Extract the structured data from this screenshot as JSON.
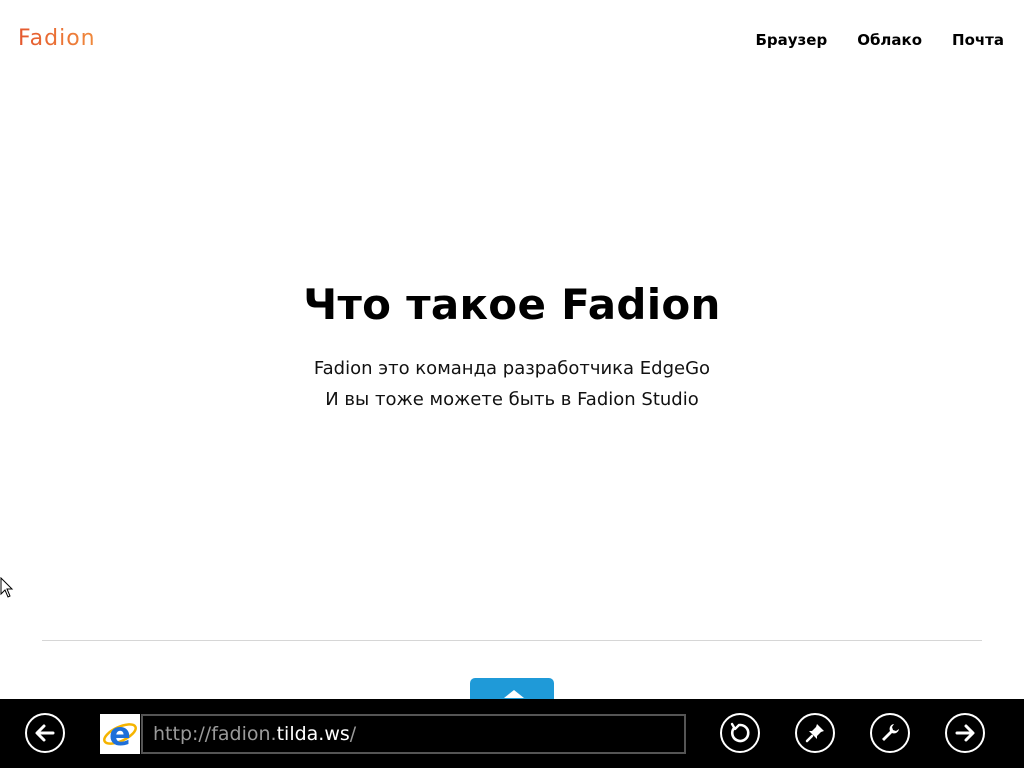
{
  "header": {
    "logo": "Fadion",
    "nav": [
      "Браузер",
      "Облако",
      "Почта"
    ]
  },
  "hero": {
    "title": "Что такое Fadion",
    "line1": "Fadion это команда разработчика EdgeGo",
    "line2": "И вы тоже можете быть в Fadion Studio"
  },
  "colors": {
    "logo": "#e4572e",
    "button": "#1f9ad8",
    "appbar": "#000000"
  },
  "appbar": {
    "url_prefix": "http://fadion.",
    "url_host": "tilda.ws",
    "url_suffix": "/",
    "buttons": [
      "back-icon",
      "refresh-icon",
      "pin-icon",
      "tools-icon",
      "forward-icon"
    ]
  }
}
